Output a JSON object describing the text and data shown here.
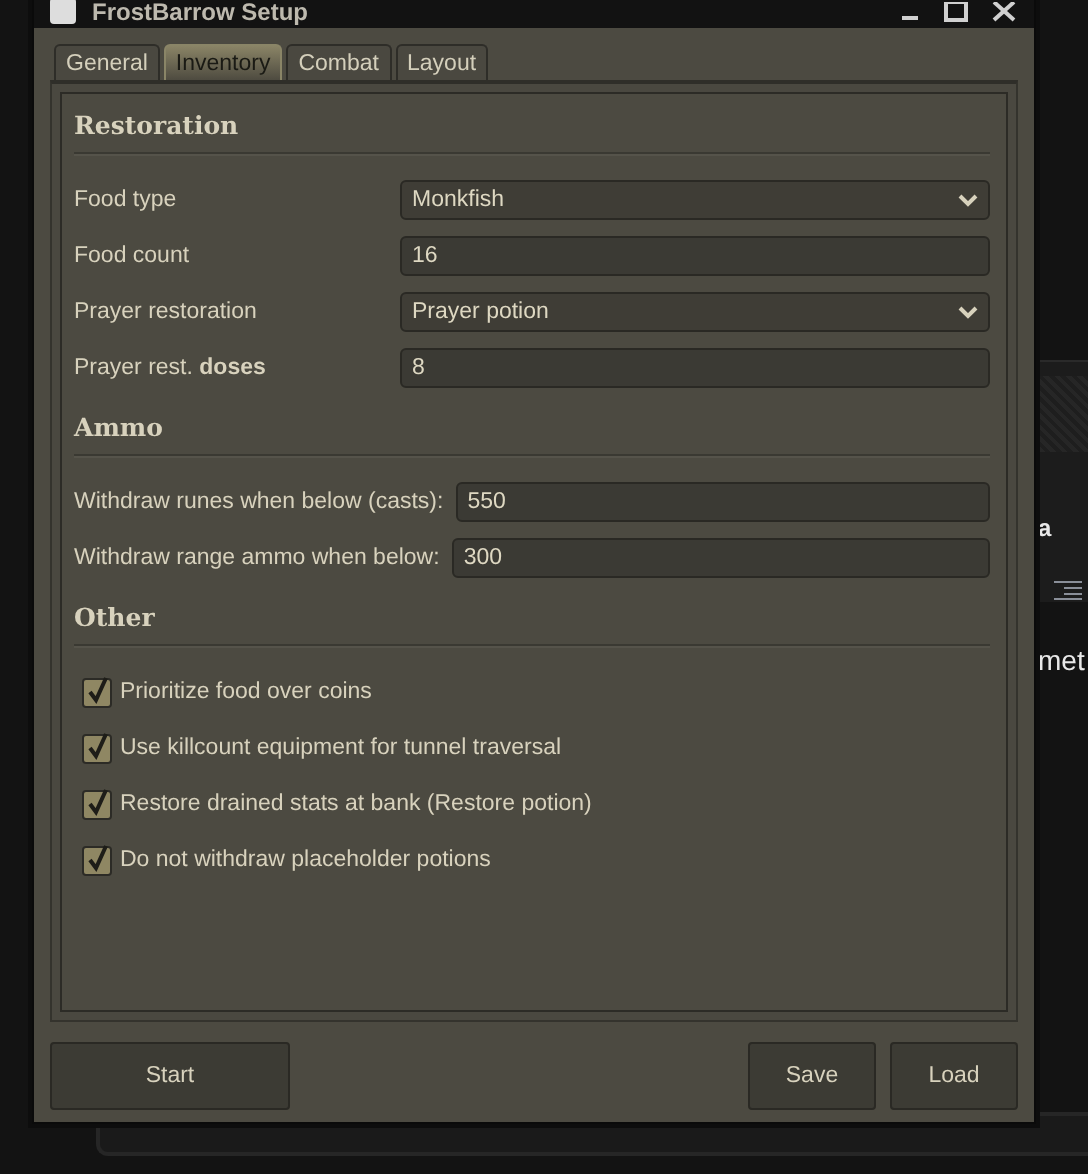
{
  "background": {
    "texts": [
      "a",
      "met"
    ]
  },
  "window": {
    "title": "FrostBarrow Setup"
  },
  "tabs": [
    {
      "label": "General",
      "selected": false
    },
    {
      "label": "Inventory",
      "selected": true
    },
    {
      "label": "Combat",
      "selected": false
    },
    {
      "label": "Layout",
      "selected": false
    }
  ],
  "sections": [
    {
      "title": "Restoration",
      "fields": [
        {
          "label": "Food type",
          "kind": "dropdown",
          "value": "Monkfish"
        },
        {
          "label": "Food count",
          "kind": "text",
          "value": "16"
        },
        {
          "label": "Prayer restoration",
          "kind": "dropdown",
          "value": "Prayer potion"
        },
        {
          "label": "Prayer rest. **doses**",
          "kind": "text",
          "value": "8"
        }
      ]
    },
    {
      "title": "Ammo",
      "fields": [
        {
          "label": "Withdraw runes when below (casts):",
          "kind": "text",
          "value": "550"
        },
        {
          "label": "Withdraw range ammo when below:",
          "kind": "text",
          "value": "300"
        }
      ]
    },
    {
      "title": "Other",
      "fields": [
        {
          "label": "Prioritize food over coins",
          "kind": "checkbox",
          "checked": true
        },
        {
          "label": "Use killcount equipment for tunnel traversal",
          "kind": "checkbox",
          "checked": true
        },
        {
          "label": "Restore drained stats at bank (Restore potion)",
          "kind": "checkbox",
          "checked": true
        },
        {
          "label": "Do not withdraw placeholder potions",
          "kind": "checkbox",
          "checked": true
        }
      ]
    }
  ],
  "buttons_left": [
    "Start"
  ],
  "buttons_right": [
    "Save",
    "Load"
  ]
}
